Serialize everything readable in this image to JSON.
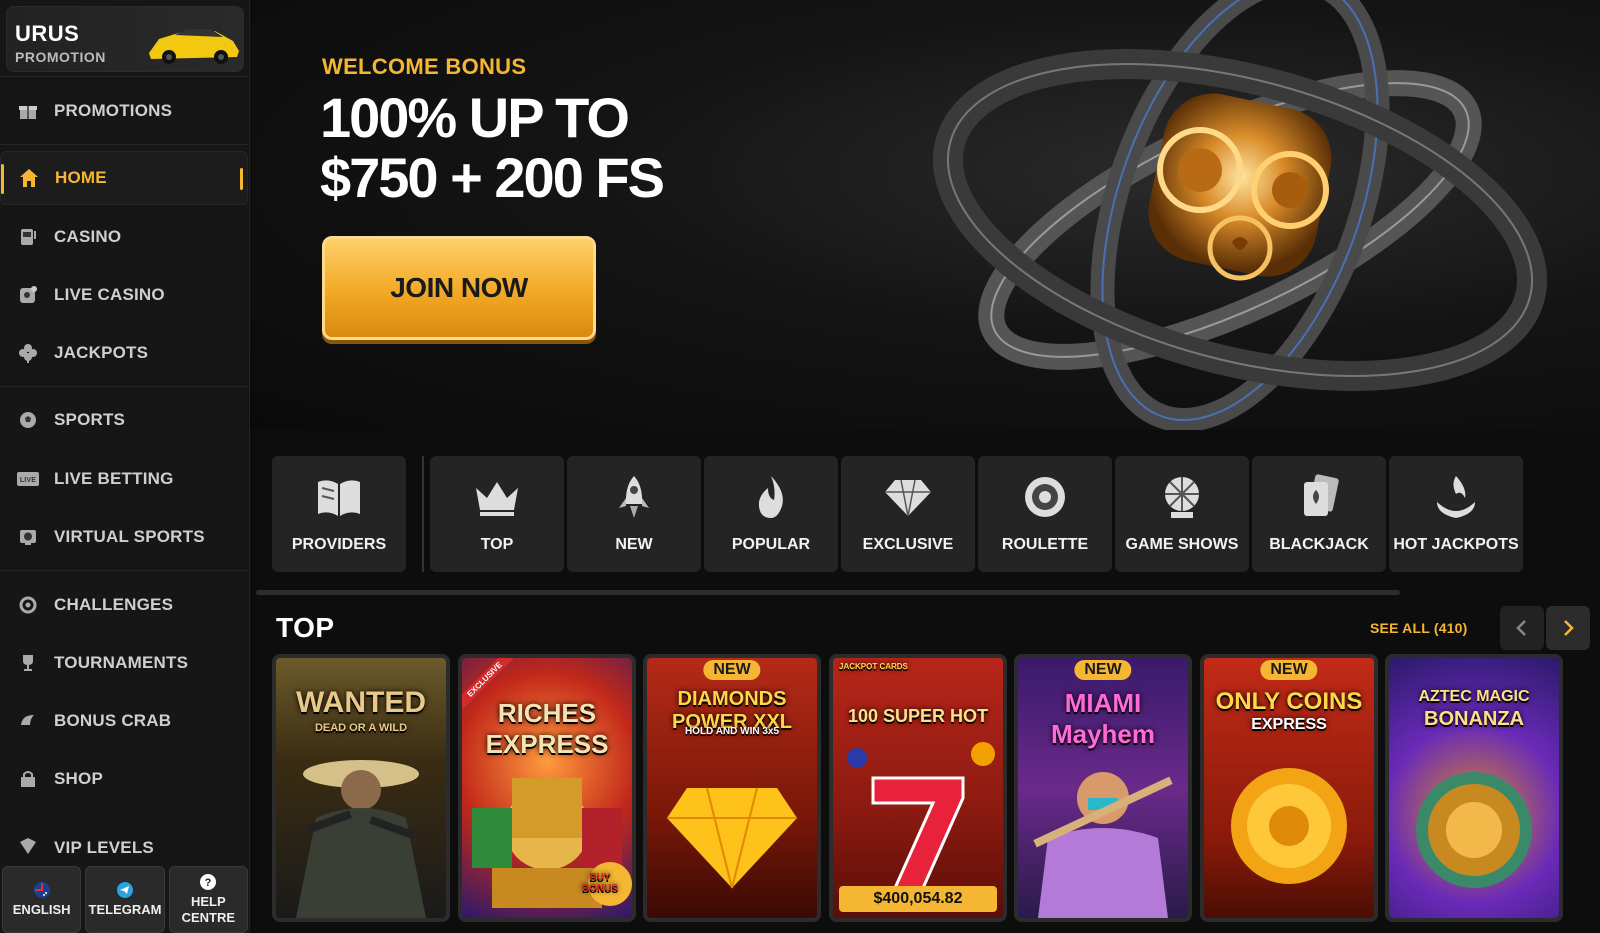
{
  "brand": {
    "promo_title": "URUS",
    "promo_subtitle": "PROMOTION"
  },
  "sidebar": {
    "items": [
      {
        "label": "PROMOTIONS",
        "icon": "gift-icon"
      },
      {
        "label": "HOME",
        "icon": "home-icon",
        "active": true
      },
      {
        "label": "CASINO",
        "icon": "slot-machine-icon"
      },
      {
        "label": "LIVE CASINO",
        "icon": "live-casino-icon"
      },
      {
        "label": "JACKPOTS",
        "icon": "clover-icon"
      },
      {
        "label": "SPORTS",
        "icon": "soccer-ball-icon"
      },
      {
        "label": "LIVE BETTING",
        "icon": "live-badge-icon"
      },
      {
        "label": "VIRTUAL SPORTS",
        "icon": "virtual-sports-icon"
      },
      {
        "label": "CHALLENGES",
        "icon": "challenge-icon"
      },
      {
        "label": "TOURNAMENTS",
        "icon": "trophy-icon"
      },
      {
        "label": "BONUS CRAB",
        "icon": "crab-icon"
      },
      {
        "label": "SHOP",
        "icon": "shop-icon"
      },
      {
        "label": "VIP LEVELS",
        "icon": "vip-icon"
      }
    ],
    "bottom": [
      {
        "label": "ENGLISH",
        "icon": "flag-icon"
      },
      {
        "label": "TELEGRAM",
        "icon": "telegram-icon"
      },
      {
        "label": "HELP CENTRE",
        "icon": "help-icon"
      }
    ]
  },
  "hero": {
    "eyebrow": "WELCOME BONUS",
    "headline_line1": "100% UP TO",
    "headline_line2": "$750 + 200 FS",
    "cta": "JOIN NOW"
  },
  "categories": [
    {
      "label": "PROVIDERS",
      "icon": "book-icon"
    },
    {
      "label": "TOP",
      "icon": "crown-icon"
    },
    {
      "label": "NEW",
      "icon": "rocket-icon"
    },
    {
      "label": "POPULAR",
      "icon": "flame-icon"
    },
    {
      "label": "EXCLUSIVE",
      "icon": "diamond-icon"
    },
    {
      "label": "ROULETTE",
      "icon": "roulette-icon"
    },
    {
      "label": "GAME SHOWS",
      "icon": "wheel-icon"
    },
    {
      "label": "BLACKJACK",
      "icon": "cards-icon"
    },
    {
      "label": "HOT JACKPOTS",
      "icon": "hot-jackpot-icon"
    }
  ],
  "top_section": {
    "title": "TOP",
    "see_all": "SEE ALL (410)",
    "games": [
      {
        "title": "WANTED",
        "subtitle": "DEAD OR A WILD",
        "badge": ""
      },
      {
        "title": "RICHES EXPRESS",
        "subtitle": "BUY BONUS",
        "badge": "EXCLUSIVE"
      },
      {
        "title": "DIAMONDS POWER XXL",
        "subtitle": "HOLD AND WIN 3x5",
        "badge": "NEW"
      },
      {
        "title": "100 SUPER HOT",
        "subtitle": "JACKPOT CARDS",
        "badge": "",
        "jackpot": "$400,054.82"
      },
      {
        "title": "MIAMI Mayhem",
        "subtitle": "",
        "badge": "NEW"
      },
      {
        "title": "ONLY COINS",
        "subtitle": "EXPRESS",
        "badge": "NEW"
      },
      {
        "title": "AZTEC MAGIC",
        "subtitle": "BONANZA",
        "badge": ""
      }
    ]
  },
  "colors": {
    "accent": "#f5b733",
    "background": "#0d0d0d",
    "panel": "#242424"
  }
}
